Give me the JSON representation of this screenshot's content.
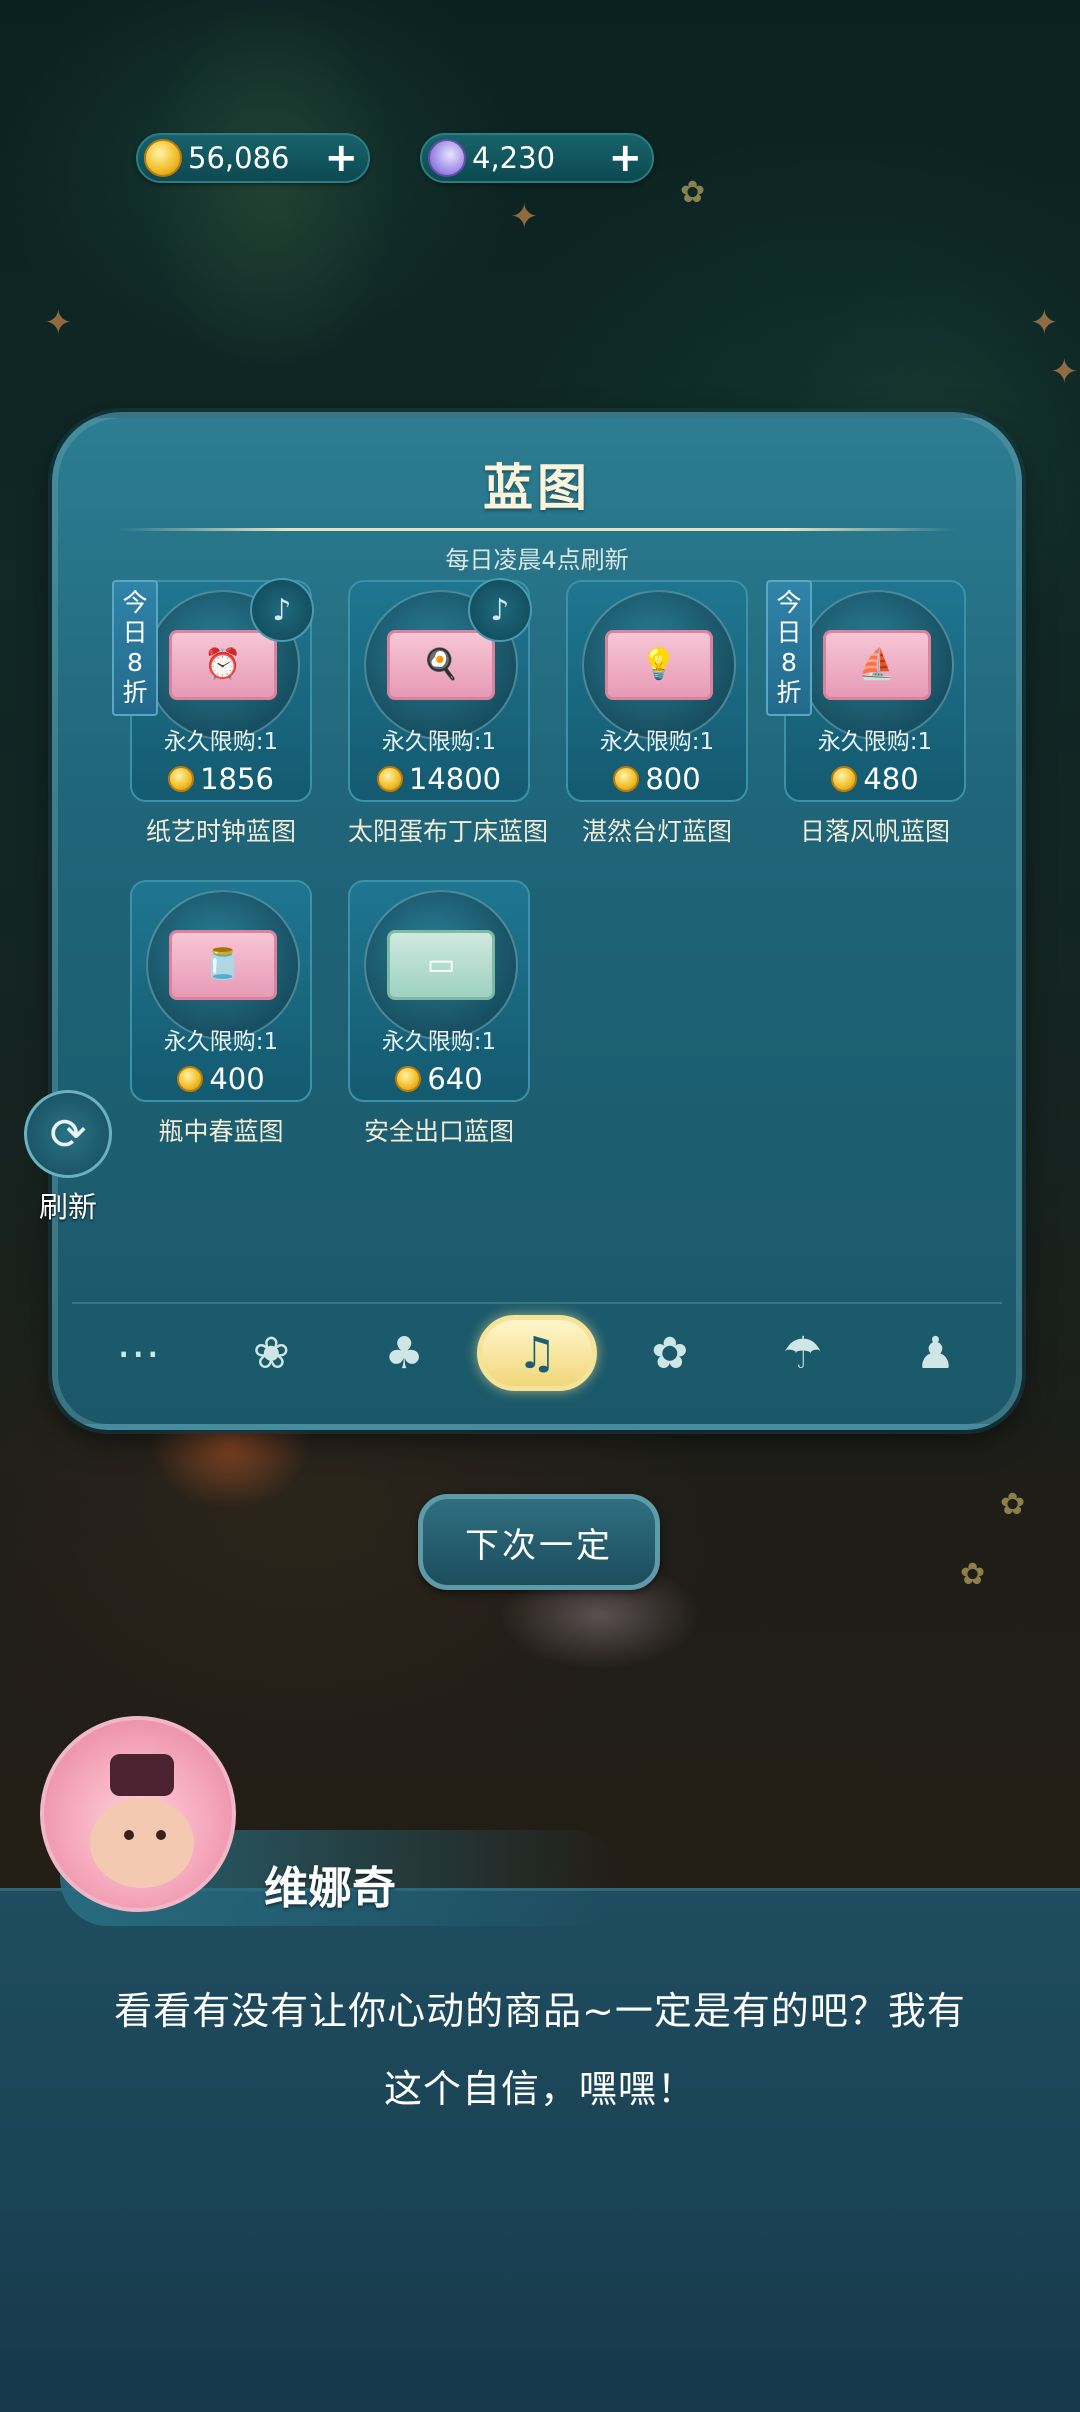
{
  "currencies": {
    "coins": {
      "value": "56,086",
      "icon": "coin-icon"
    },
    "moon": {
      "value": "4,230",
      "icon": "moon-gem-icon"
    }
  },
  "panel": {
    "title": "蓝图",
    "subtitle": "每日凌晨4点刷新"
  },
  "items": [
    {
      "name": "纸艺时钟蓝图",
      "limit": "永久限购:1",
      "price": "1856",
      "badge": [
        "今",
        "日",
        "8",
        "折"
      ],
      "replay": true,
      "obj": "⏰",
      "obj_icon": "clock-icon"
    },
    {
      "name": "太阳蛋布丁床蓝图",
      "limit": "永久限购:1",
      "price": "14800",
      "badge": null,
      "replay": true,
      "obj": "🍳",
      "obj_icon": "egg-bed-icon"
    },
    {
      "name": "湛然台灯蓝图",
      "limit": "永久限购:1",
      "price": "800",
      "badge": null,
      "replay": false,
      "obj": "💡",
      "obj_icon": "lamp-icon"
    },
    {
      "name": "日落风帆蓝图",
      "limit": "永久限购:1",
      "price": "480",
      "badge": [
        "今",
        "日",
        "8",
        "折"
      ],
      "replay": false,
      "obj": "⛵",
      "obj_icon": "sailboat-icon"
    },
    {
      "name": "瓶中春蓝图",
      "limit": "永久限购:1",
      "price": "400",
      "badge": null,
      "replay": false,
      "obj": "🫙",
      "obj_icon": "jar-icon"
    },
    {
      "name": "安全出口蓝图",
      "limit": "永久限购:1",
      "price": "640",
      "badge": null,
      "replay": false,
      "obj": "▭",
      "obj_icon": "exit-sign-icon",
      "green": true
    }
  ],
  "tabs": [
    {
      "icon": "more-icon",
      "glyph": "⋯"
    },
    {
      "icon": "food-tab-icon",
      "glyph": "❀"
    },
    {
      "icon": "bag-tab-icon",
      "glyph": "♣"
    },
    {
      "icon": "blueprint-tab-icon",
      "glyph": "♫",
      "active": true
    },
    {
      "icon": "lamp-tab-icon",
      "glyph": "✿"
    },
    {
      "icon": "umbrella-tab-icon",
      "glyph": "☂"
    },
    {
      "icon": "clothes-tab-icon",
      "glyph": "♟"
    }
  ],
  "refresh_label": "刷新",
  "next_button": "下次一定",
  "dialog": {
    "speaker": "维娜奇",
    "text_line1": "看看有没有让你心动的商品~一定是有的吧？我有",
    "text_line2": "这个自信，嘿嘿！"
  }
}
